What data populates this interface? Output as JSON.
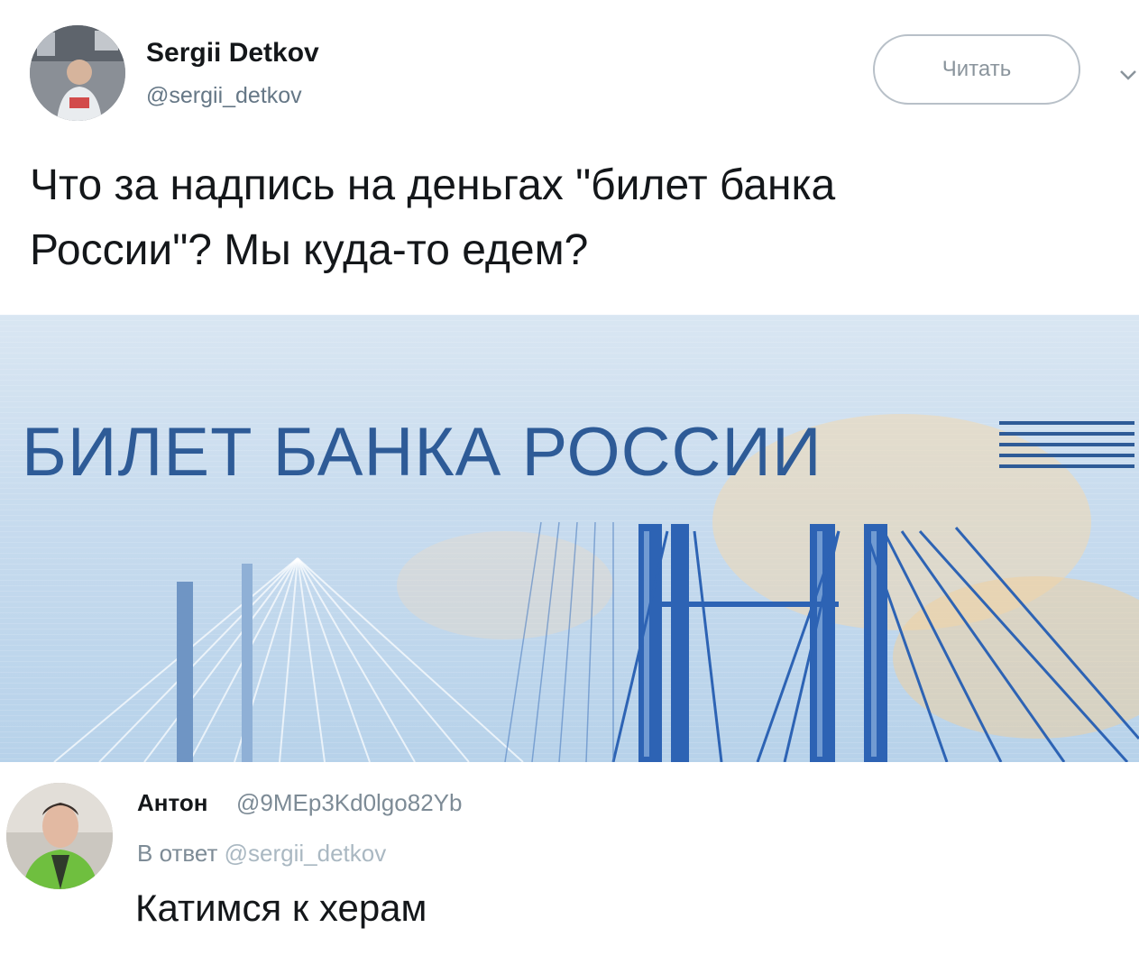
{
  "tweet": {
    "author_name": "Sergii Detkov",
    "author_handle": "@sergii_detkov",
    "follow_label": "Читать",
    "text": "Что за надпись на деньгах \"билет банка\nРоссии\"? Мы куда-то едем?",
    "media": {
      "banknote_text": "БИЛЕТ БАНКА РОССИИ"
    }
  },
  "reply": {
    "author_name": "Антон",
    "author_handle": "@9MEp3Kd0lgo82Yb",
    "reply_prefix": "В ответ",
    "reply_to": "@sergii_detkov",
    "text": "Катимся к херам"
  },
  "colors": {
    "text": "#14171a",
    "secondary": "#657786",
    "follow_border": "#b8c0c8",
    "banknote_blue": "#2e5b97"
  },
  "icons": {
    "chevron": "chevron-down-icon"
  }
}
